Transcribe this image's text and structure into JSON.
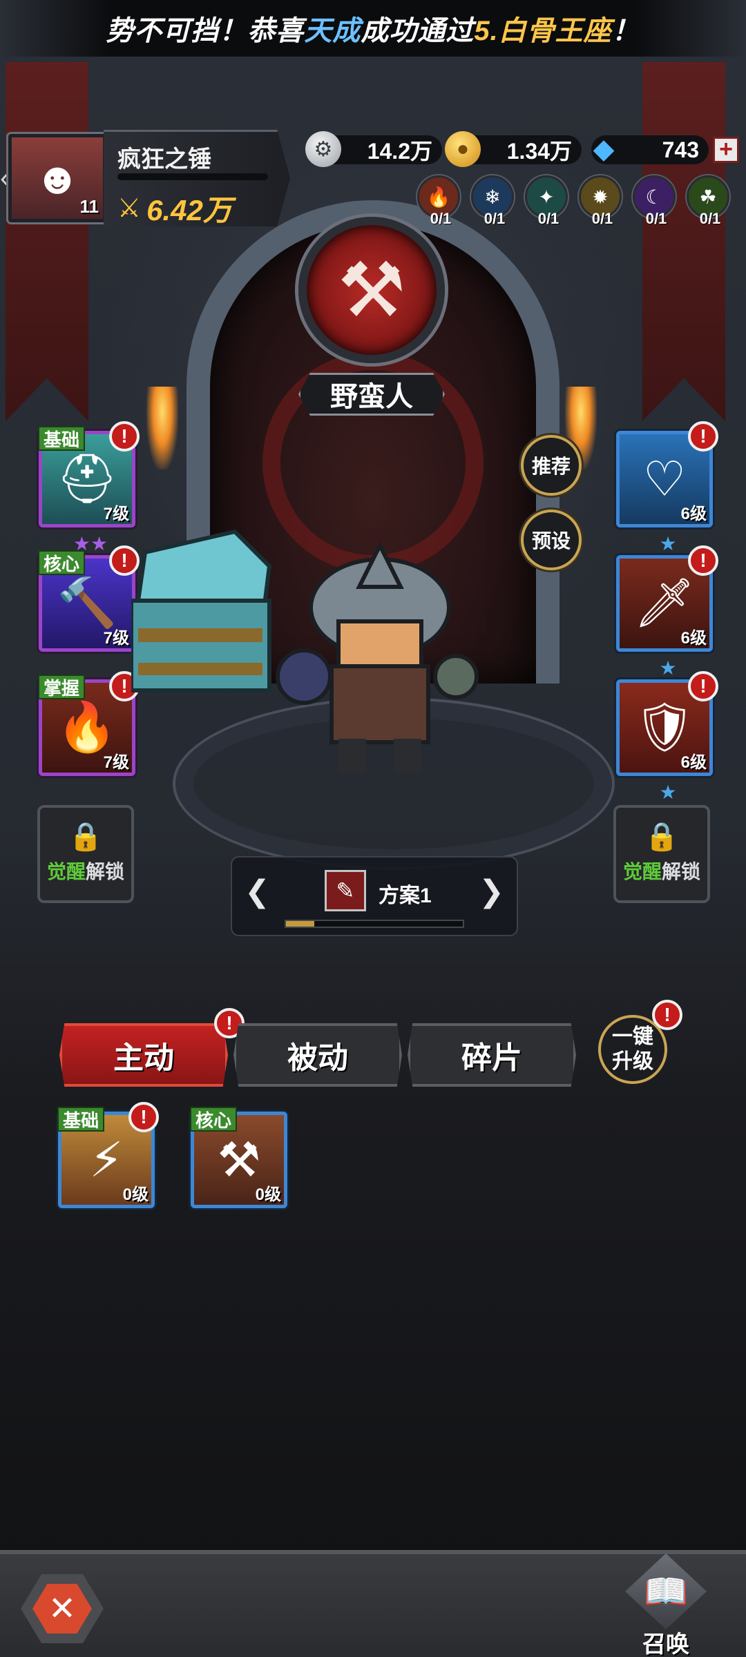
{
  "announcement": {
    "part1": "势不可挡！恭喜",
    "name": "天成",
    "part2": "成功通过",
    "stage": "5.白骨王座",
    "part3": "！"
  },
  "player": {
    "name": "疯狂之锤",
    "level": "11",
    "power": "6.42万",
    "xp_progress": 0.0
  },
  "currencies": {
    "silver": "14.2万",
    "gold": "1.34万",
    "gems": "743",
    "plus": "+"
  },
  "tokens": [
    {
      "icon": "fire-rune-icon",
      "count": "0/1",
      "color": "#6b2a1c"
    },
    {
      "icon": "frost-rune-icon",
      "count": "0/1",
      "color": "#1d3a5c"
    },
    {
      "icon": "nature-rune-icon",
      "count": "0/1",
      "color": "#1d4a44"
    },
    {
      "icon": "earth-rune-icon",
      "count": "0/1",
      "color": "#5a4a1c"
    },
    {
      "icon": "shadow-rune-icon",
      "count": "0/1",
      "color": "#3d2064"
    },
    {
      "icon": "poison-rune-icon",
      "count": "0/1",
      "color": "#2a4a1c"
    }
  ],
  "hero_class": {
    "name": "野蛮人",
    "icon": "axe-emblem-icon"
  },
  "left_skills": [
    {
      "tag": "基础",
      "level": "7级",
      "stars": 2,
      "alert": "!"
    },
    {
      "tag": "核心",
      "level": "7级",
      "stars": 0,
      "alert": "!"
    },
    {
      "tag": "掌握",
      "level": "7级",
      "stars": 0,
      "alert": "!"
    }
  ],
  "right_skills": [
    {
      "level": "6级",
      "stars": 1,
      "alert": "!"
    },
    {
      "level": "6级",
      "stars": 1,
      "alert": "!"
    },
    {
      "level": "6级",
      "stars": 1,
      "alert": "!"
    }
  ],
  "side_buttons": {
    "recommend": "推荐",
    "preset": "预设"
  },
  "awaken": {
    "highlight": "觉醒",
    "text": "解锁"
  },
  "preset_selector": {
    "label": "方案1",
    "progress": 0.16
  },
  "tabs": {
    "active": "主动",
    "passive": "被动",
    "fragments": "碎片"
  },
  "one_key": {
    "line1": "一键",
    "line2": "升级",
    "alert": "!"
  },
  "tab_alert": "!",
  "active_skills": [
    {
      "tag": "基础",
      "level": "0级",
      "alert": "!"
    },
    {
      "tag": "核心",
      "level": "0级"
    }
  ],
  "bottom": {
    "summon": "召唤"
  }
}
